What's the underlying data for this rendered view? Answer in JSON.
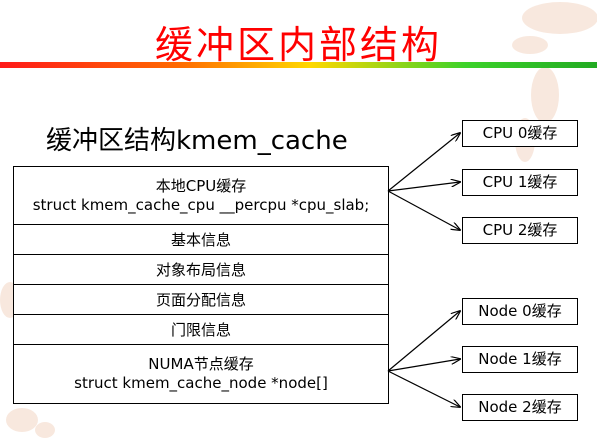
{
  "title": "缓冲区内部结构",
  "subtitle": "缓冲区结构kmem_cache",
  "struct_rows": [
    {
      "line1": "本地CPU缓存",
      "line2": "struct kmem_cache_cpu __percpu *cpu_slab;"
    },
    {
      "line1": "基本信息"
    },
    {
      "line1": "对象布局信息"
    },
    {
      "line1": "页面分配信息"
    },
    {
      "line1": "门限信息"
    },
    {
      "line1": "NUMA节点缓存",
      "line2": "struct kmem_cache_node *node[]"
    }
  ],
  "cpu_caches": [
    "CPU 0缓存",
    "CPU 1缓存",
    "CPU 2缓存"
  ],
  "node_caches": [
    "Node 0缓存",
    "Node 1缓存",
    "Node 2缓存"
  ],
  "colors": {
    "title": "#ff0000",
    "line": "#000000"
  }
}
